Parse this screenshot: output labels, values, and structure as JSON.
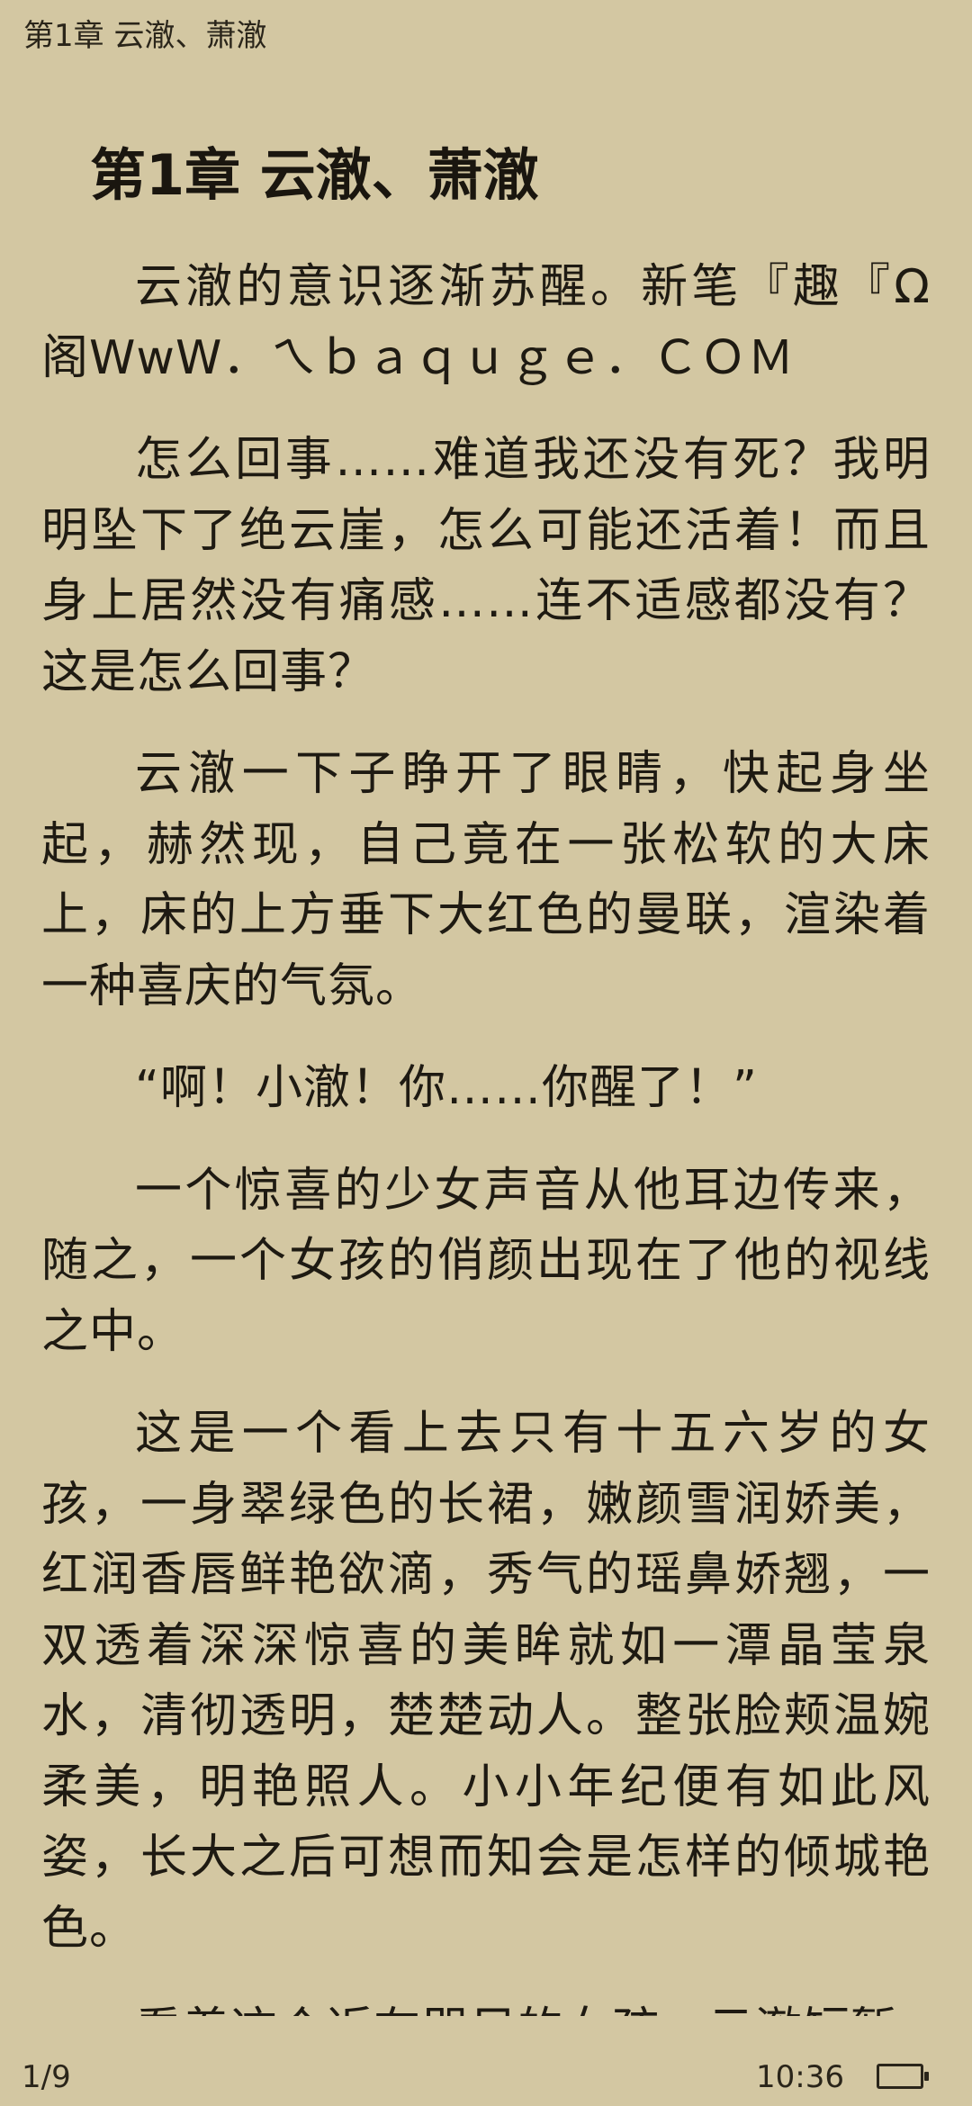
{
  "header": {
    "chapter": "第1章 云澈、萧澈"
  },
  "chapter_title": "第1章 云澈、萧澈",
  "paragraphs": [
    "云澈的意识逐渐苏醒。新笔『趣『Ω阁WwW．ㄟｂａｑｕｇｅ．ＣＯＭ",
    "怎么回事……难道我还没有死？我明明坠下了绝云崖，怎么可能还活着！而且身上居然没有痛感……连不适感都没有？这是怎么回事？",
    "云澈一下子睁开了眼睛，快起身坐起，赫然现，自己竟在一张松软的大床上，床的上方垂下大红色的曼联，渲染着一种喜庆的气氛。",
    "“啊！小澈！你……你醒了！”",
    "一个惊喜的少女声音从他耳边传来，随之，一个女孩的俏颜出现在了他的视线之中。",
    "这是一个看上去只有十五六岁的女孩，一身翠绿色的长裙，嫩颜雪润娇美，红润香唇鲜艳欲滴，秀气的瑶鼻娇翘，一双透着深深惊喜的美眸就如一潭晶莹泉水，清彻透明，楚楚动人。整张脸颊温婉柔美，明艳照人。小小年纪便有如此风姿，长大之后可想而知会是怎样的倾城艳色。",
    "看着这个近在咫尺的女孩，云澈短暂"
  ],
  "footer": {
    "page": "1/9",
    "time": "10:36"
  },
  "battery_icon": "battery-icon"
}
